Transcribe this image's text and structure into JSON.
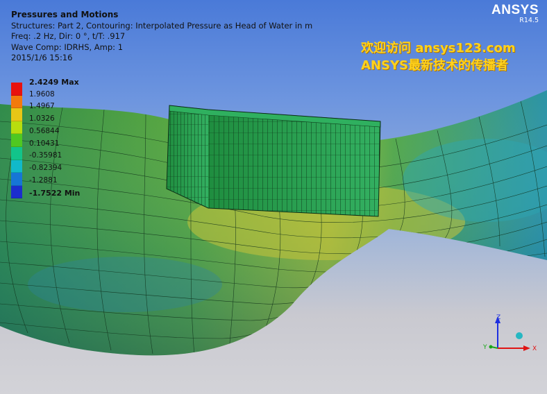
{
  "app": {
    "brand": "ANSYS",
    "version": "R14.5"
  },
  "info": {
    "title": "Pressures and Motions",
    "line1": "Structures: Part 2, Contouring: Interpolated Pressure as Head of Water in m",
    "line2": "Freq: .2 Hz, Dir: 0 °, t/T: .917",
    "line3": "Wave Comp: IDRHS, Amp: 1",
    "line4": "2015/1/6 15:16"
  },
  "watermark": {
    "line1": "欢迎访问 ansys123.com",
    "line2": "ANSYS最新技术的传播者"
  },
  "legend": {
    "max": "2.4249 Max",
    "min": "-1.7522 Min",
    "values": [
      "1.9608",
      "1.4967",
      "1.0326",
      "0.56844",
      "0.10431",
      "-0.35981",
      "-0.82394",
      "-1.2881"
    ],
    "colors": [
      "#e8120e",
      "#f27a0c",
      "#e7c616",
      "#b8dd0e",
      "#4fc821",
      "#12c48a",
      "#11b9c9",
      "#1676d6",
      "#1b2ecd"
    ]
  },
  "colors": {
    "surface_green": "#3c9a44",
    "surface_yellow": "#b5c23a",
    "surface_cyan": "#2f9fa8",
    "box": "#2aa457",
    "sky": "#4a7ad8",
    "floor": "#cfcfd4"
  },
  "triad": {
    "x": "X",
    "y": "Y",
    "z": "Z"
  }
}
